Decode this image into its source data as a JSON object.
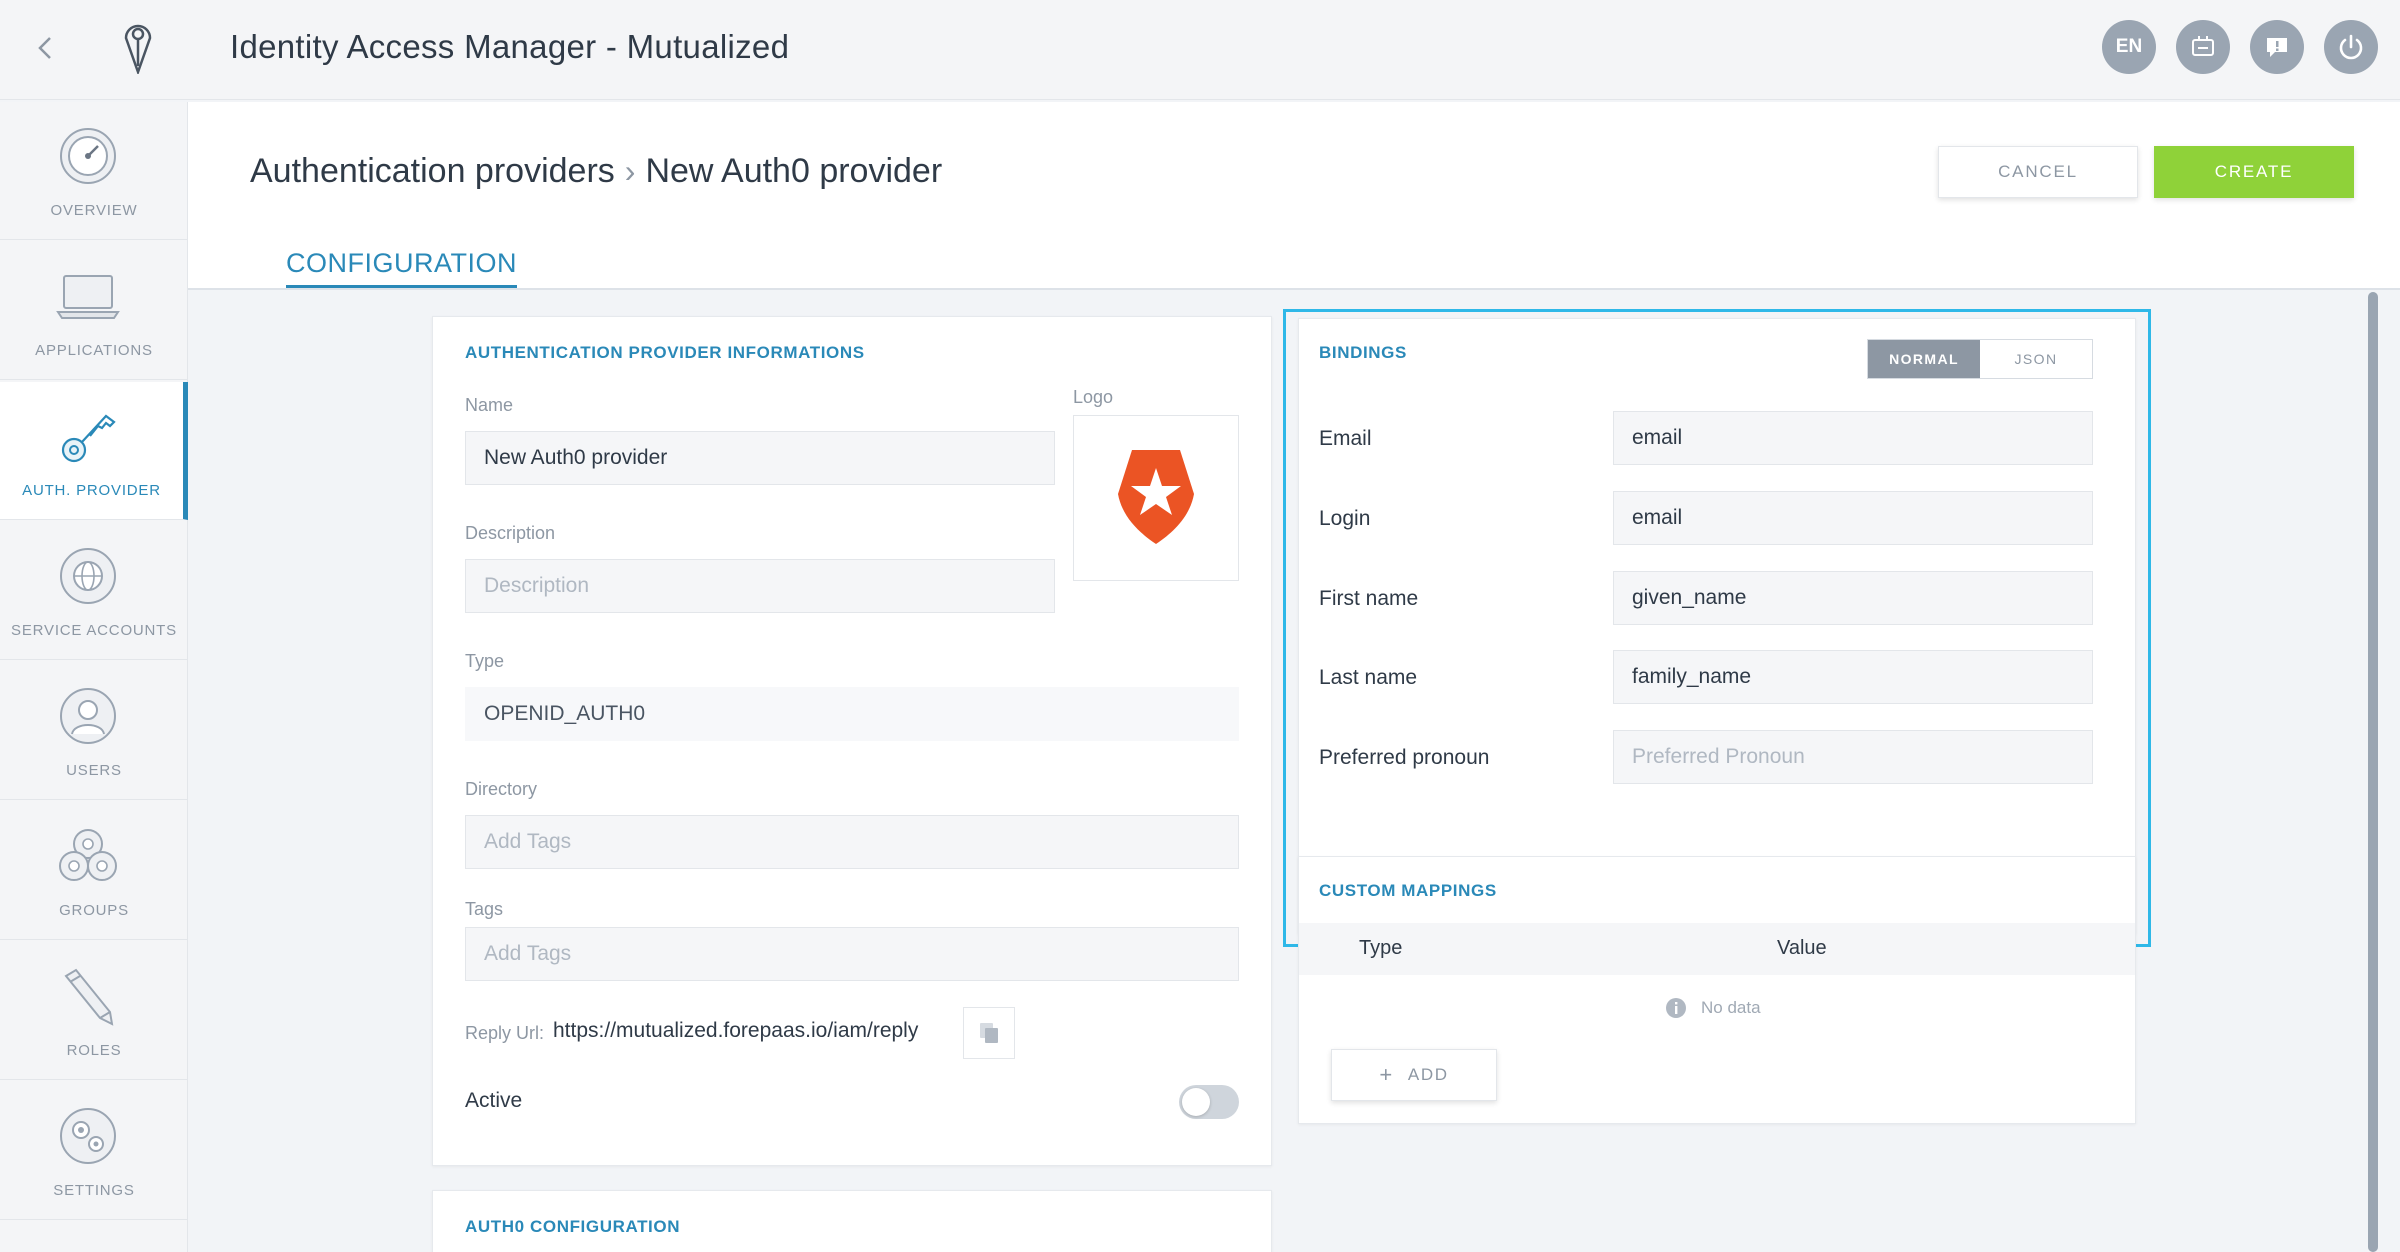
{
  "header": {
    "title": "Identity Access Manager - Mutualized",
    "language": "EN"
  },
  "sidebar": {
    "items": [
      {
        "label": "OVERVIEW",
        "icon": "gauge-icon"
      },
      {
        "label": "APPLICATIONS",
        "icon": "laptop-icon"
      },
      {
        "label": "AUTH. PROVIDER",
        "icon": "key-icon",
        "active": true
      },
      {
        "label": "SERVICE ACCOUNTS",
        "icon": "globe-icon"
      },
      {
        "label": "USERS",
        "icon": "user-icon"
      },
      {
        "label": "GROUPS",
        "icon": "group-icon"
      },
      {
        "label": "ROLES",
        "icon": "pencil-icon"
      },
      {
        "label": "SETTINGS",
        "icon": "gears-icon"
      }
    ]
  },
  "page": {
    "breadcrumb_parent": "Authentication providers",
    "breadcrumb_current": "New Auth0 provider",
    "cancel_label": "CANCEL",
    "create_label": "CREATE",
    "tab_label": "CONFIGURATION"
  },
  "info_card": {
    "title": "AUTHENTICATION PROVIDER INFORMATIONS",
    "name_label": "Name",
    "name_value": "New Auth0 provider",
    "logo_label": "Logo",
    "description_label": "Description",
    "description_placeholder": "Description",
    "type_label": "Type",
    "type_value": "OPENID_AUTH0",
    "directory_label": "Directory",
    "directory_placeholder": "Add Tags",
    "tags_label": "Tags",
    "tags_placeholder": "Add Tags",
    "reply_url_label": "Reply Url:",
    "reply_url_value": "https://mutualized.forepaas.io/iam/reply",
    "active_label": "Active",
    "active": false
  },
  "auth0_card": {
    "title": "AUTH0 CONFIGURATION"
  },
  "bindings": {
    "title": "BINDINGS",
    "mode_normal": "NORMAL",
    "mode_json": "JSON",
    "selected_mode": "NORMAL",
    "fields": [
      {
        "label": "Email",
        "value": "email"
      },
      {
        "label": "Login",
        "value": "email"
      },
      {
        "label": "First name",
        "value": "given_name"
      },
      {
        "label": "Last name",
        "value": "family_name"
      },
      {
        "label": "Preferred pronoun",
        "placeholder": "Preferred Pronoun"
      }
    ],
    "highlight_color": "#2fb8e8"
  },
  "custom_mappings": {
    "title": "CUSTOM MAPPINGS",
    "col_type": "Type",
    "col_value": "Value",
    "empty_text": "No data",
    "add_label": "ADD"
  },
  "colors": {
    "accent": "#2a89b8",
    "create": "#8fd239",
    "auth0_logo": "#eb5424"
  }
}
